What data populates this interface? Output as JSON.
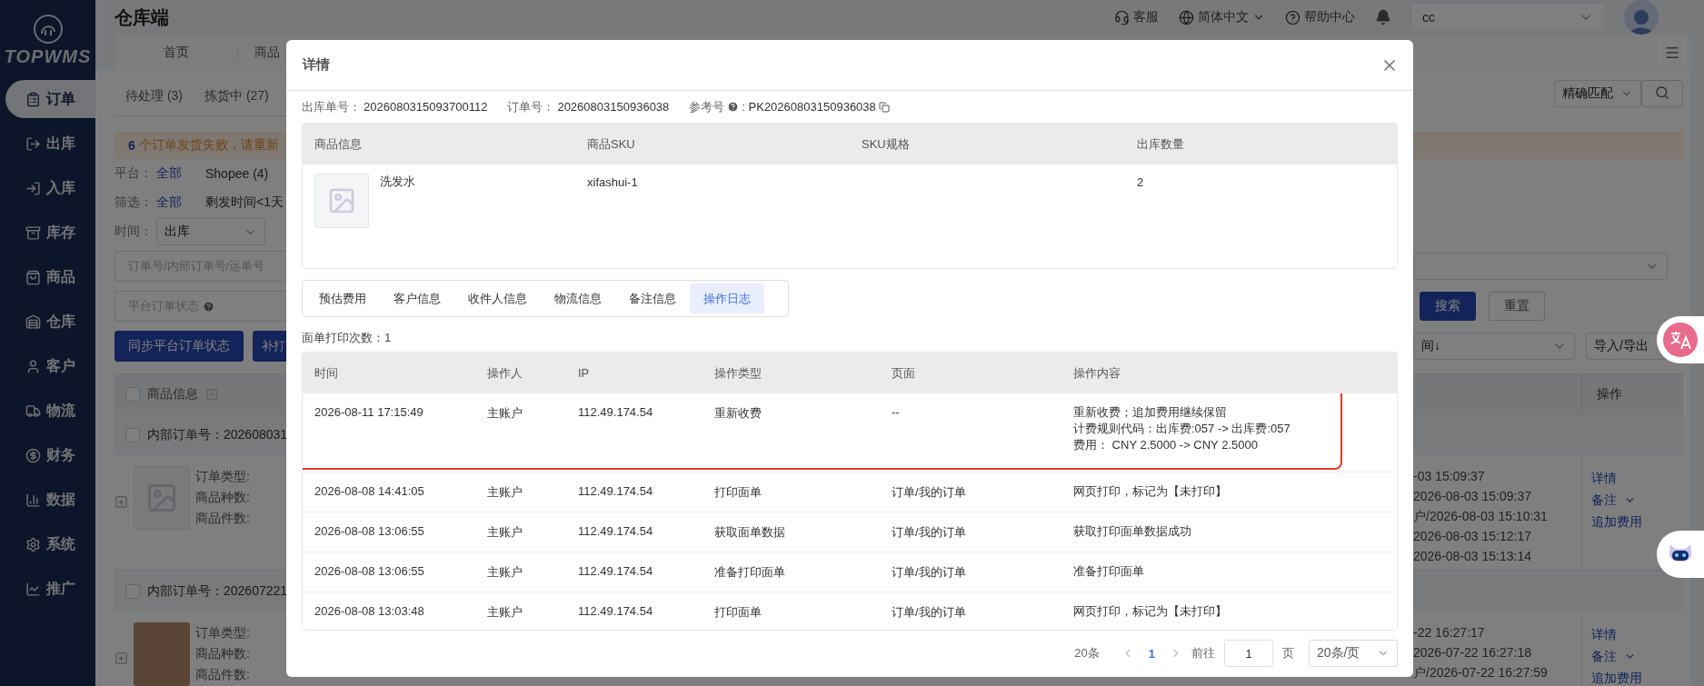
{
  "sidebar": {
    "logo": "TOPWMS",
    "items": [
      {
        "label": "订单",
        "selected": true
      },
      {
        "label": "出库",
        "selected": false
      },
      {
        "label": "入库",
        "selected": false
      },
      {
        "label": "库存",
        "selected": false
      },
      {
        "label": "商品",
        "selected": false
      },
      {
        "label": "仓库",
        "selected": false
      },
      {
        "label": "客户",
        "selected": false
      },
      {
        "label": "物流",
        "selected": false
      },
      {
        "label": "财务",
        "selected": false
      },
      {
        "label": "数据",
        "selected": false
      },
      {
        "label": "系统",
        "selected": false
      },
      {
        "label": "推广",
        "selected": false
      }
    ]
  },
  "header": {
    "title": "仓库端",
    "links": [
      "客服",
      "简体中文",
      "帮助中心"
    ],
    "account": "cc"
  },
  "page_tabs": [
    "首页",
    "商品"
  ],
  "orders": {
    "status_tabs": [
      "待处理 (3)",
      "拣货中 (27)"
    ],
    "match_mode": "精确匹配",
    "alert": {
      "count": "6",
      "text": "个订单发货失败，请重新"
    },
    "platform": {
      "label": "平台：",
      "options": [
        {
          "label": "全部",
          "selected": true
        },
        {
          "label": "Shopee (4)",
          "selected": false
        }
      ]
    },
    "filter": {
      "label": "筛选：",
      "options": [
        {
          "label": "全部",
          "selected": true
        },
        {
          "label": "剩发时间<1天",
          "selected": false
        }
      ]
    },
    "time": {
      "label": "时间：",
      "value": "出库"
    },
    "search_placeholder": "订单号/内部订单号/运单号",
    "status_placeholder": "平台订单状态",
    "buttons": [
      "同步平台订单状态",
      "补打"
    ],
    "search_button": "搜索",
    "reset_button": "重置",
    "sort": "间↓",
    "export": "导入/导出",
    "table": {
      "columns": [
        "商品信息",
        "操作"
      ],
      "all_checked": false,
      "orders": [
        {
          "number": "内部订单号：202608031",
          "checked": false,
          "photo": false,
          "fields": [
            "订单类型:",
            "商品种数:",
            "商品件数:"
          ],
          "times": [
            "-03 15:09:37",
            "2026-08-03 15:09:37",
            "户/2026-08-03 15:10:31",
            "2026-08-03 15:12:17",
            "2026-08-03 15:13:14"
          ],
          "actions": [
            "详情",
            "备注",
            "追加费用"
          ]
        },
        {
          "number": "内部订单号：202607221",
          "checked": false,
          "photo": true,
          "fields": [
            "订单类型:",
            "商品种数:",
            "商品件数:"
          ],
          "times": [
            "-22 16:27:17",
            "2026-07-22 16:27:18",
            "户/2026-07-22 16:27:59"
          ],
          "actions": [
            "详情",
            "备注",
            "追加费用"
          ]
        }
      ]
    }
  },
  "dialog": {
    "title": "详情",
    "info": [
      {
        "kind": "plain",
        "label": "出库单号：",
        "value": "2026080315093700112"
      },
      {
        "kind": "plain",
        "label": "订单号：",
        "value": "20260803150936038"
      },
      {
        "kind": "reference",
        "label": "参考号",
        "value": ": PK20260803150936038"
      }
    ],
    "products": {
      "columns": [
        "商品信息",
        "商品SKU",
        "SKU规格",
        "出库数量"
      ],
      "rows": [
        {
          "name": "洗发水",
          "sku": "xifashui-1",
          "quantity": "2"
        }
      ]
    },
    "tabs": [
      {
        "label": "预估费用",
        "selected": false
      },
      {
        "label": "客户信息",
        "selected": false
      },
      {
        "label": "收件人信息",
        "selected": false
      },
      {
        "label": "物流信息",
        "selected": false
      },
      {
        "label": "备注信息",
        "selected": false
      },
      {
        "label": "操作日志",
        "selected": true
      }
    ],
    "print_count": "面单打印次数：1",
    "log": {
      "columns": [
        "时间",
        "操作人",
        "IP",
        "操作类型",
        "页面",
        "操作内容"
      ],
      "rows": [
        {
          "time": "2026-08-11 17:15:49",
          "operator": "主账户",
          "ip": "112.49.174.54",
          "type": "重新收费",
          "page": "--",
          "content": [
            "重新收费；追加费用继续保留",
            "计费规则代码：出库费:057 -> 出库费:057",
            "费用：  CNY 2.5000 -> CNY 2.5000"
          ],
          "highlighted": true
        },
        {
          "time": "2026-08-08 14:41:05",
          "operator": "主账户",
          "ip": "112.49.174.54",
          "type": "打印面单",
          "page": "订单/我的订单",
          "content": [
            "网页打印，标记为【未打印】"
          ],
          "highlighted": false
        },
        {
          "time": "2026-08-08 13:06:55",
          "operator": "主账户",
          "ip": "112.49.174.54",
          "type": "获取面单数据",
          "page": "订单/我的订单",
          "content": [
            "获取打印面单数据成功"
          ],
          "highlighted": false
        },
        {
          "time": "2026-08-08 13:06:55",
          "operator": "主账户",
          "ip": "112.49.174.54",
          "type": "准备打印面单",
          "page": "订单/我的订单",
          "content": [
            "准备打印面单"
          ],
          "highlighted": false
        },
        {
          "time": "2026-08-08 13:03:48",
          "operator": "主账户",
          "ip": "112.49.174.54",
          "type": "打印面单",
          "page": "订单/我的订单",
          "content": [
            "网页打印，标记为【未打印】"
          ],
          "highlighted": false
        }
      ]
    },
    "pagination": {
      "total": "20条",
      "pages": [
        {
          "label": "1",
          "selected": true
        }
      ],
      "goto_label": "前往",
      "goto_value": "1",
      "page_unit": "页",
      "page_size": "20条/页"
    }
  }
}
